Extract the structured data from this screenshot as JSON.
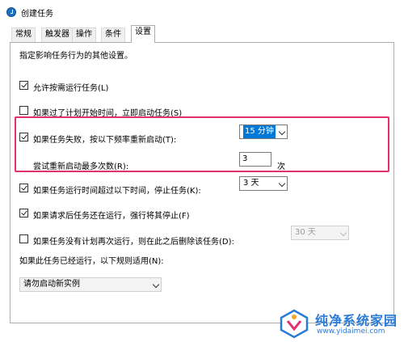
{
  "window": {
    "title": "创建任务"
  },
  "tabs": [
    {
      "label": "常规",
      "active": false
    },
    {
      "label": "触发器",
      "active": false
    },
    {
      "label": "操作",
      "active": false
    },
    {
      "label": "条件",
      "active": false
    },
    {
      "label": "设置",
      "active": true
    }
  ],
  "settings": {
    "description": "指定影响任务行为的其他设置。",
    "allow_on_demand": {
      "label": "允许按需运行任务(L)",
      "checked": true
    },
    "run_asap_missed": {
      "label": "如果过了计划开始时间，立即启动任务(S)",
      "checked": false
    },
    "restart_on_fail": {
      "label": "如果任务失败，按以下频率重新启动(T):",
      "checked": true
    },
    "restart_interval": {
      "value": "15 分钟"
    },
    "restart_attempts": {
      "label": "尝试重新启动最多次数(R):",
      "value": "3",
      "unit": "次"
    },
    "stop_if_runs_longer": {
      "label": "如果任务运行时间超过以下时间，停止任务(K):",
      "checked": true,
      "value": "3 天"
    },
    "force_stop": {
      "label": "如果请求后任务还在运行，强行将其停止(F)",
      "checked": true
    },
    "delete_if_not_scheduled": {
      "label": "如果任务没有计划再次运行，则在此之后删除该任务(D):",
      "checked": false,
      "value": "30 天"
    },
    "if_running_rule": {
      "label": "如果此任务已经运行，以下规则适用(N):",
      "value": "请勿启动新实例"
    }
  },
  "watermark": {
    "title": "纯净系统家园",
    "url": "www.yidaimei.com"
  },
  "colors": {
    "highlight_border": "#e3306e",
    "selection": "#0078d7",
    "watermark": "#2b7ad6"
  }
}
